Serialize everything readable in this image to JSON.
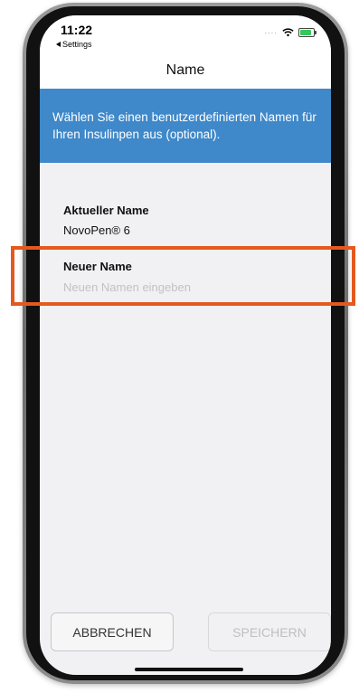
{
  "status_bar": {
    "time": "11:22",
    "back_app": "Settings",
    "wifi_icon": "wifi-icon",
    "battery_icon": "battery-charging-icon"
  },
  "nav": {
    "title": "Name"
  },
  "banner": {
    "text": "Wählen Sie einen benutzerdefinierten Namen für Ihren Insulinpen aus (optional).",
    "color": "#3f88c9"
  },
  "current_name": {
    "label": "Aktueller Name",
    "value": "NovoPen® 6"
  },
  "new_name": {
    "label": "Neuer Name",
    "value": "",
    "placeholder": "Neuen Namen eingeben"
  },
  "buttons": {
    "cancel": "ABBRECHEN",
    "save": "SPEICHERN"
  },
  "colors": {
    "highlight": "#e4591e",
    "screen_bg": "#f1f1f3"
  }
}
